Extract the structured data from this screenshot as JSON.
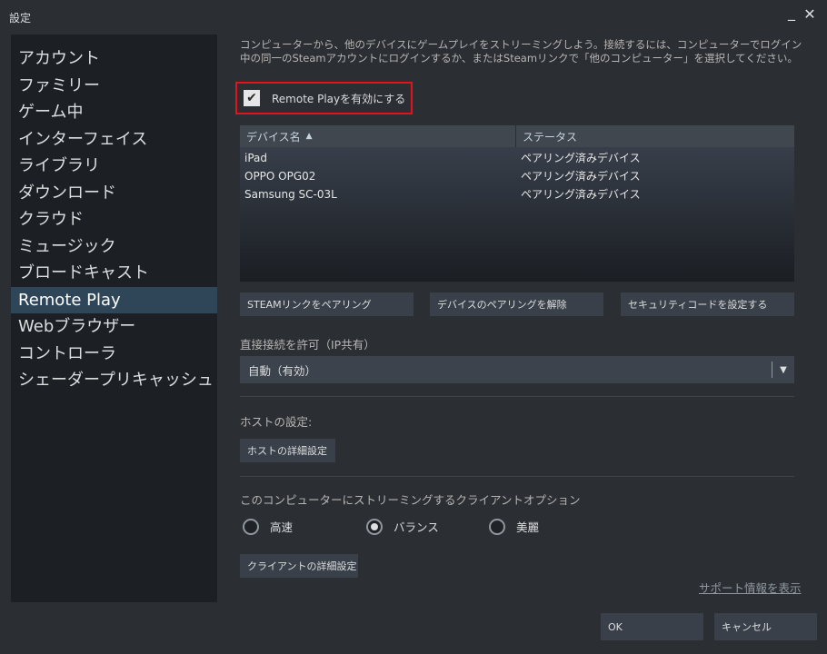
{
  "window": {
    "title": "設定",
    "minimize_glyph": "_",
    "close_glyph": "✕"
  },
  "sidebar": {
    "items": [
      {
        "label": "アカウント"
      },
      {
        "label": "ファミリー"
      },
      {
        "label": "ゲーム中"
      },
      {
        "label": "インターフェイス"
      },
      {
        "label": "ライブラリ"
      },
      {
        "label": "ダウンロード"
      },
      {
        "label": "クラウド"
      },
      {
        "label": "ミュージック"
      },
      {
        "label": "ブロードキャスト"
      },
      {
        "label": "Remote Play",
        "active": true
      },
      {
        "label": "Webブラウザー"
      },
      {
        "label": "コントローラ"
      },
      {
        "label": "シェーダープリキャッシュ"
      }
    ]
  },
  "main": {
    "intro": "コンピューターから、他のデバイスにゲームプレイをストリーミングしよう。接続するには、コンピューターでログイン中の同一のSteamアカウントにログインするか、またはSteamリンクで「他のコンピューター」を選択してください。",
    "enable_label": "Remote Playを有効にする",
    "enable_checked": true,
    "table": {
      "col_name": "デバイス名",
      "col_status": "ステータス",
      "sort_icon": "▲",
      "rows": [
        {
          "name": "iPad",
          "status": "ペアリング済みデバイス"
        },
        {
          "name": "OPPO OPG02",
          "status": "ペアリング済みデバイス"
        },
        {
          "name": "Samsung SC-03L",
          "status": "ペアリング済みデバイス"
        }
      ]
    },
    "buttons": {
      "pair_steam_link": "STEAMリンクをペアリング",
      "unpair_devices": "デバイスのペアリングを解除",
      "set_security_code": "セキュリティコードを設定する"
    },
    "direct_connect_label": "直接接続を許可（IP共有）",
    "direct_connect_value": "自動（有効）",
    "host_label": "ホストの設定:",
    "host_advanced": "ホストの詳細設定",
    "client_label": "このコンピューターにストリーミングするクライアントオプション",
    "client_options": [
      {
        "label": "高速",
        "selected": false
      },
      {
        "label": "バランス",
        "selected": true
      },
      {
        "label": "美麗",
        "selected": false
      }
    ],
    "client_advanced": "クライアントの詳細設定",
    "support_link": "サポート情報を表示"
  },
  "footer": {
    "ok": "OK",
    "cancel": "キャンセル"
  }
}
